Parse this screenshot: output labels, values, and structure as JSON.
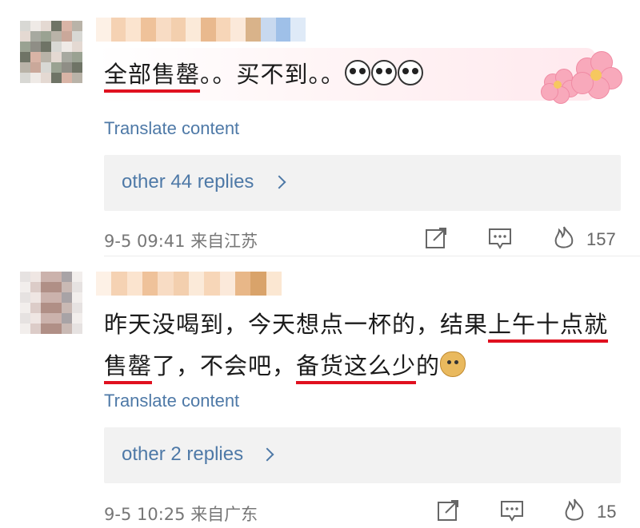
{
  "comments": [
    {
      "text_parts": [
        {
          "t": "全部售罄",
          "u": true
        },
        {
          "t": "。。买不到。。",
          "u": false
        }
      ],
      "emojis": [
        "panda-face-emoji",
        "panda-face-emoji",
        "panda-face-emoji"
      ],
      "translate": "Translate content",
      "replies": "other 44 replies",
      "time": "9-5 09:41",
      "location": "来自江苏",
      "like_count": "157"
    },
    {
      "line1_parts": [
        {
          "t": "昨天没喝到，今天想点一杯的，结果",
          "u": false
        },
        {
          "t": "上午十点就",
          "u": true
        }
      ],
      "line2_parts": [
        {
          "t": "售罄",
          "u": true
        },
        {
          "t": "了，不会吧，",
          "u": false
        },
        {
          "t": "备货这么少",
          "u": true
        },
        {
          "t": "的",
          "u": false
        }
      ],
      "emoji": "doge-emoji",
      "translate": "Translate content",
      "replies": "other 2 replies",
      "time": "9-5 10:25",
      "location": "来自广东",
      "like_count": "15"
    }
  ],
  "icons": [
    "share-icon",
    "comment-icon",
    "like-fire-icon",
    "chevron-right-icon"
  ],
  "colors": {
    "link": "#4e79a7",
    "underline": "#e0101f",
    "meta": "#777777"
  }
}
